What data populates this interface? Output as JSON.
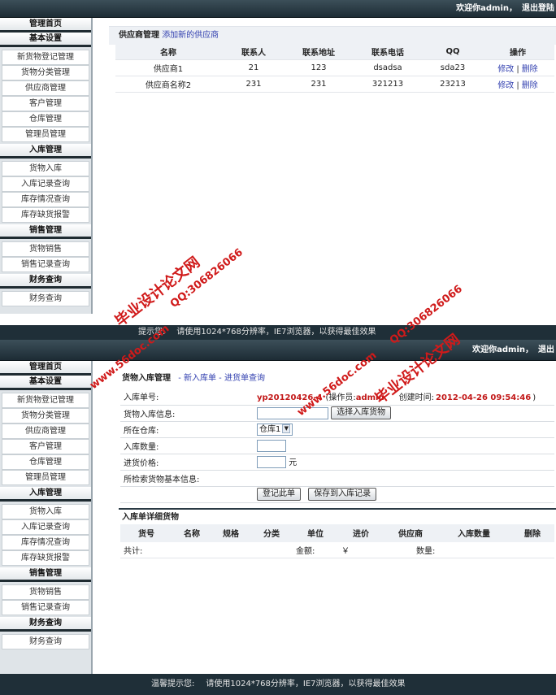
{
  "header": {
    "top_welcome": "欢迎你admin，",
    "top_logout": "退出登陆",
    "bottom_welcome": "欢迎你admin，",
    "bottom_logout": "退出"
  },
  "sidebar": {
    "sections": [
      {
        "title": "管理首页",
        "items": []
      },
      {
        "title": "基本设置",
        "items": [
          "新货物登记管理",
          "货物分类管理",
          "供应商管理",
          "客户管理",
          "仓库管理",
          "管理员管理"
        ]
      },
      {
        "title": "入库管理",
        "items": [
          "货物入库",
          "入库记录查询",
          "库存情况查询",
          "库存缺货报警"
        ]
      },
      {
        "title": "销售管理",
        "items": [
          "货物销售",
          "销售记录查询"
        ]
      },
      {
        "title": "财务查询",
        "items": [
          "财务查询"
        ]
      }
    ]
  },
  "supplier": {
    "title": "供应商管理",
    "add_link": "添加新的供应商",
    "columns": [
      "名称",
      "联系人",
      "联系地址",
      "联系电话",
      "QQ",
      "操作"
    ],
    "rows": [
      {
        "name": "供应商1",
        "contact": "21",
        "address": "123",
        "phone": "dsadsa",
        "qq": "sda23"
      },
      {
        "name": "供应商名称2",
        "contact": "231",
        "address": "231",
        "phone": "321213",
        "qq": "23213"
      }
    ],
    "edit_label": "修改",
    "sep": "|",
    "delete_label": "删除"
  },
  "stock_in": {
    "title": "货物入库管理",
    "crumb_sep1": "-",
    "crumb_new": "新入库单",
    "crumb_sep2": "-",
    "crumb_query": "进货单查询",
    "fields": {
      "order_label": "入库单号:",
      "order_no": "yp20120426-4",
      "operator_label": "(操作员:",
      "operator": "admin",
      "created_label": "创建时间:",
      "created_time": "2012-04-26 09:54:46",
      "created_close": ")",
      "goods_label": "货物入库信息:",
      "choose_button": "选择入库货物",
      "warehouse_label": "所在仓库:",
      "warehouse_value": "仓库1",
      "qty_label": "入库数量:",
      "price_label": "进货价格:",
      "price_unit": "元",
      "basic_label": "所检索货物基本信息:",
      "register_button": "登记此单",
      "save_button": "保存到入库记录"
    },
    "detail": {
      "title": "入库单详细货物",
      "columns": [
        "货号",
        "名称",
        "规格",
        "分类",
        "单位",
        "进价",
        "供应商",
        "入库数量",
        "删除"
      ],
      "total_label": "共计:",
      "amount_label": "金额:",
      "currency": "￥",
      "qty_label": "数量:"
    }
  },
  "footer": {
    "top_label": "提示您:",
    "top_text": "请使用1024*768分辨率，IE7浏览器，以获得最佳效果",
    "bottom_label": "温馨提示您:",
    "bottom_text": "请使用1024*768分辨率，IE7浏览器，以获得最佳效果"
  },
  "watermarks": {
    "cn": "毕业设计论文网",
    "qq": "QQ:306826066",
    "site": "www.56doc.com"
  },
  "colors": {
    "header_bg": "#1d2c35",
    "accent_red": "#c21818",
    "link_blue": "#3341b0",
    "watermark_red": "#d01a1a"
  }
}
